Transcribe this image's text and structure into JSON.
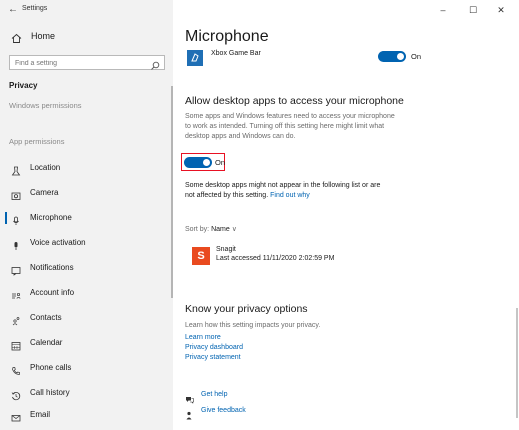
{
  "window": {
    "title": "Settings",
    "controls": {
      "minimize": "–",
      "maximize": "☐",
      "close": "✕"
    }
  },
  "sidebar": {
    "back": "←",
    "home": {
      "label": "Home",
      "icon": "home-icon"
    },
    "search": {
      "placeholder": "Find a setting",
      "icon": "search-icon"
    },
    "section_title": "Privacy",
    "windows_permissions": "Windows permissions",
    "app_permissions": "App permissions",
    "items": [
      {
        "label": "Location",
        "icon": "location-icon",
        "selected": false
      },
      {
        "label": "Camera",
        "icon": "camera-icon",
        "selected": false
      },
      {
        "label": "Microphone",
        "icon": "microphone-icon",
        "selected": true
      },
      {
        "label": "Voice activation",
        "icon": "voice-activation-icon",
        "selected": false
      },
      {
        "label": "Notifications",
        "icon": "notifications-icon",
        "selected": false
      },
      {
        "label": "Account info",
        "icon": "account-info-icon",
        "selected": false
      },
      {
        "label": "Contacts",
        "icon": "contacts-icon",
        "selected": false
      },
      {
        "label": "Calendar",
        "icon": "calendar-icon",
        "selected": false
      },
      {
        "label": "Phone calls",
        "icon": "phone-calls-icon",
        "selected": false
      },
      {
        "label": "Call history",
        "icon": "call-history-icon",
        "selected": false
      },
      {
        "label": "Email",
        "icon": "email-icon",
        "selected": false
      }
    ]
  },
  "main": {
    "page_title": "Microphone",
    "xbox": {
      "name": "Xbox Game Bar",
      "toggle_state": "On"
    },
    "desktop_apps": {
      "heading": "Allow desktop apps to access your microphone",
      "description_lines": [
        "Some apps and Windows features need to access your microphone",
        "to work as intended. Turning off this setting here might limit what",
        "desktop apps and Windows can do."
      ],
      "toggle_state": "On",
      "note_line1": "Some desktop apps might not appear in the following list or are",
      "note_line2_prefix": "not affected by this setting.",
      "note_link": "Find out why"
    },
    "sort": {
      "label": "Sort by:",
      "value": "Name",
      "chevron": "∨"
    },
    "apps": [
      {
        "name": "Snagit",
        "accessed": "Last accessed 11/11/2020 2:02:59 PM",
        "tile_letter": "S"
      }
    ],
    "privacy_options": {
      "heading": "Know your privacy options",
      "description": "Learn how this setting impacts your privacy.",
      "links": [
        "Learn more",
        "Privacy dashboard",
        "Privacy statement"
      ]
    },
    "help": {
      "get_help": "Get help",
      "give_feedback": "Give feedback"
    }
  },
  "colors": {
    "accent": "#0063b1",
    "highlight": "#e81123",
    "sidebar_bg": "#f2f2f2"
  }
}
